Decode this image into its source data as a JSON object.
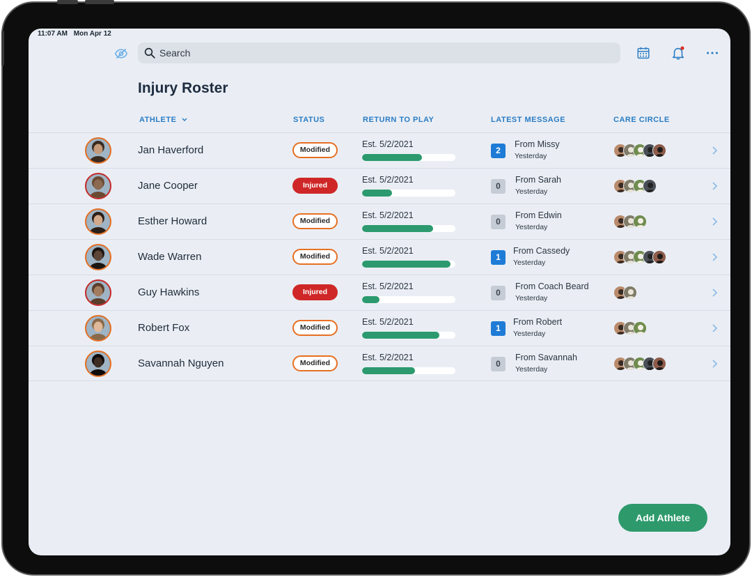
{
  "status_bar": {
    "time": "11:07 AM",
    "date": "Mon Apr 12"
  },
  "search": {
    "placeholder": "Search"
  },
  "icons": {
    "hide": "eye-off-icon",
    "calendar": "calendar-icon",
    "notifications": "bell-icon",
    "more": "more-horizontal-icon",
    "sort": "chevron-down-icon",
    "row_action": "chevron-right-icon"
  },
  "colors": {
    "accent": "#2a7cc4",
    "progress": "#2c9a6e",
    "modified": "#e76f22",
    "injured": "#cf2727",
    "unread": "#1e7bd6",
    "primary_button": "#2e9a6c"
  },
  "page": {
    "title": "Injury Roster"
  },
  "columns": {
    "athlete": "ATHLETE",
    "status": "STATUS",
    "return_to_play": "RETURN TO PLAY",
    "latest_message": "LATEST MESSAGE",
    "care_circle": "CARE CIRCLE"
  },
  "athletes": [
    {
      "name": "Jan Haverford",
      "status": "Modified",
      "status_type": "modified",
      "return": "Est. 5/2/2021",
      "progress": 0.64,
      "unread": "2",
      "from": "From Missy",
      "when": "Yesterday",
      "care_circle_size": 5
    },
    {
      "name": "Jane Cooper",
      "status": "Injured",
      "status_type": "injured",
      "return": "Est. 5/2/2021",
      "progress": 0.32,
      "unread": "0",
      "from": "From Sarah",
      "when": "Yesterday",
      "care_circle_size": 4
    },
    {
      "name": "Esther Howard",
      "status": "Modified",
      "status_type": "modified",
      "return": "Est. 5/2/2021",
      "progress": 0.76,
      "unread": "0",
      "from": "From Edwin",
      "when": "Yesterday",
      "care_circle_size": 3
    },
    {
      "name": "Wade Warren",
      "status": "Modified",
      "status_type": "modified",
      "return": "Est. 5/2/2021",
      "progress": 0.95,
      "unread": "1",
      "from": "From Cassedy",
      "when": "Yesterday",
      "care_circle_size": 5
    },
    {
      "name": "Guy Hawkins",
      "status": "Injured",
      "status_type": "injured",
      "return": "Est. 5/2/2021",
      "progress": 0.19,
      "unread": "0",
      "from": "From Coach Beard",
      "when": "Yesterday",
      "care_circle_size": 2
    },
    {
      "name": "Robert Fox",
      "status": "Modified",
      "status_type": "modified",
      "return": "Est. 5/2/2021",
      "progress": 0.83,
      "unread": "1",
      "from": "From Robert",
      "when": "Yesterday",
      "care_circle_size": 3
    },
    {
      "name": "Savannah Nguyen",
      "status": "Modified",
      "status_type": "modified",
      "return": "Est. 5/2/2021",
      "progress": 0.57,
      "unread": "0",
      "from": "From Savannah",
      "when": "Yesterday",
      "care_circle_size": 5
    }
  ],
  "actions": {
    "add_athlete": "Add Athlete"
  }
}
